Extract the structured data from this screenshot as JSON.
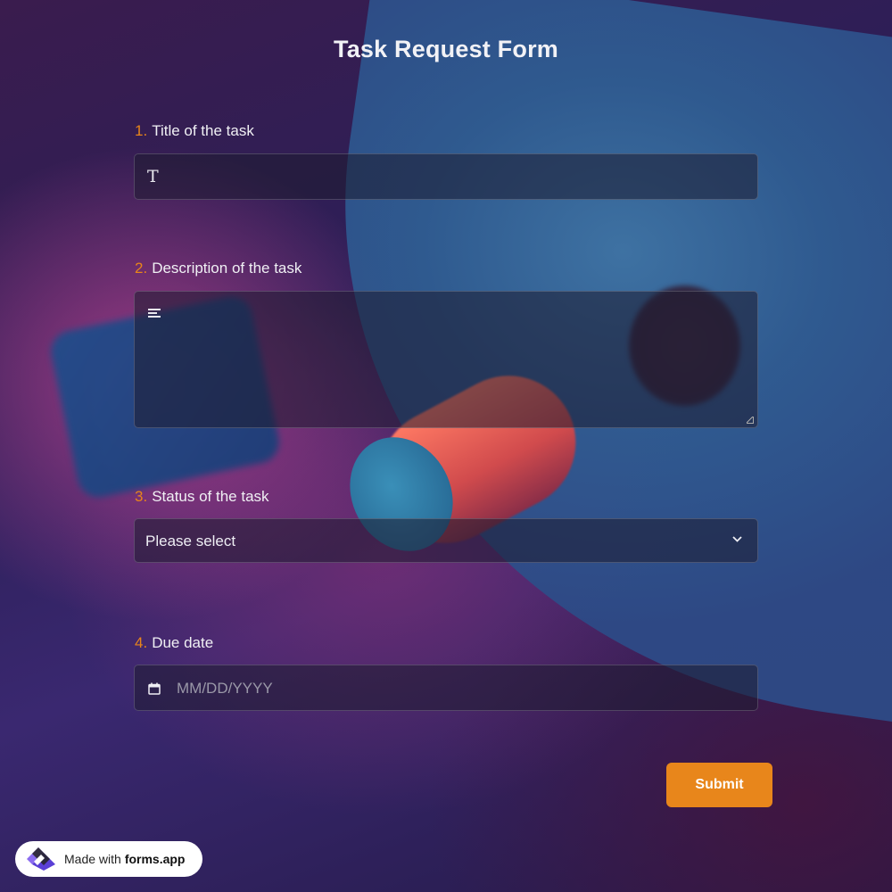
{
  "form": {
    "title": "Task Request Form",
    "questions": [
      {
        "number": "1.",
        "label": "Title of the task",
        "type": "text",
        "icon": "text-format-icon"
      },
      {
        "number": "2.",
        "label": "Description of the task",
        "type": "textarea",
        "icon": "align-lines-icon"
      },
      {
        "number": "3.",
        "label": "Status of the task",
        "type": "select",
        "selected": "Please select",
        "icon": "chevron-down-icon"
      },
      {
        "number": "4.",
        "label": "Due date",
        "type": "date",
        "placeholder": "MM/DD/YYYY",
        "icon": "calendar-icon"
      }
    ],
    "submit_label": "Submit",
    "text_icon_glyph": "T"
  },
  "badge": {
    "prefix": "Made with",
    "brand": "forms.app",
    "icon": "forms-app-logo"
  },
  "colors": {
    "accent": "#e8861b",
    "number": "#e8851a",
    "field_bg": "#1e1c30",
    "text": "#f0f0f4"
  }
}
